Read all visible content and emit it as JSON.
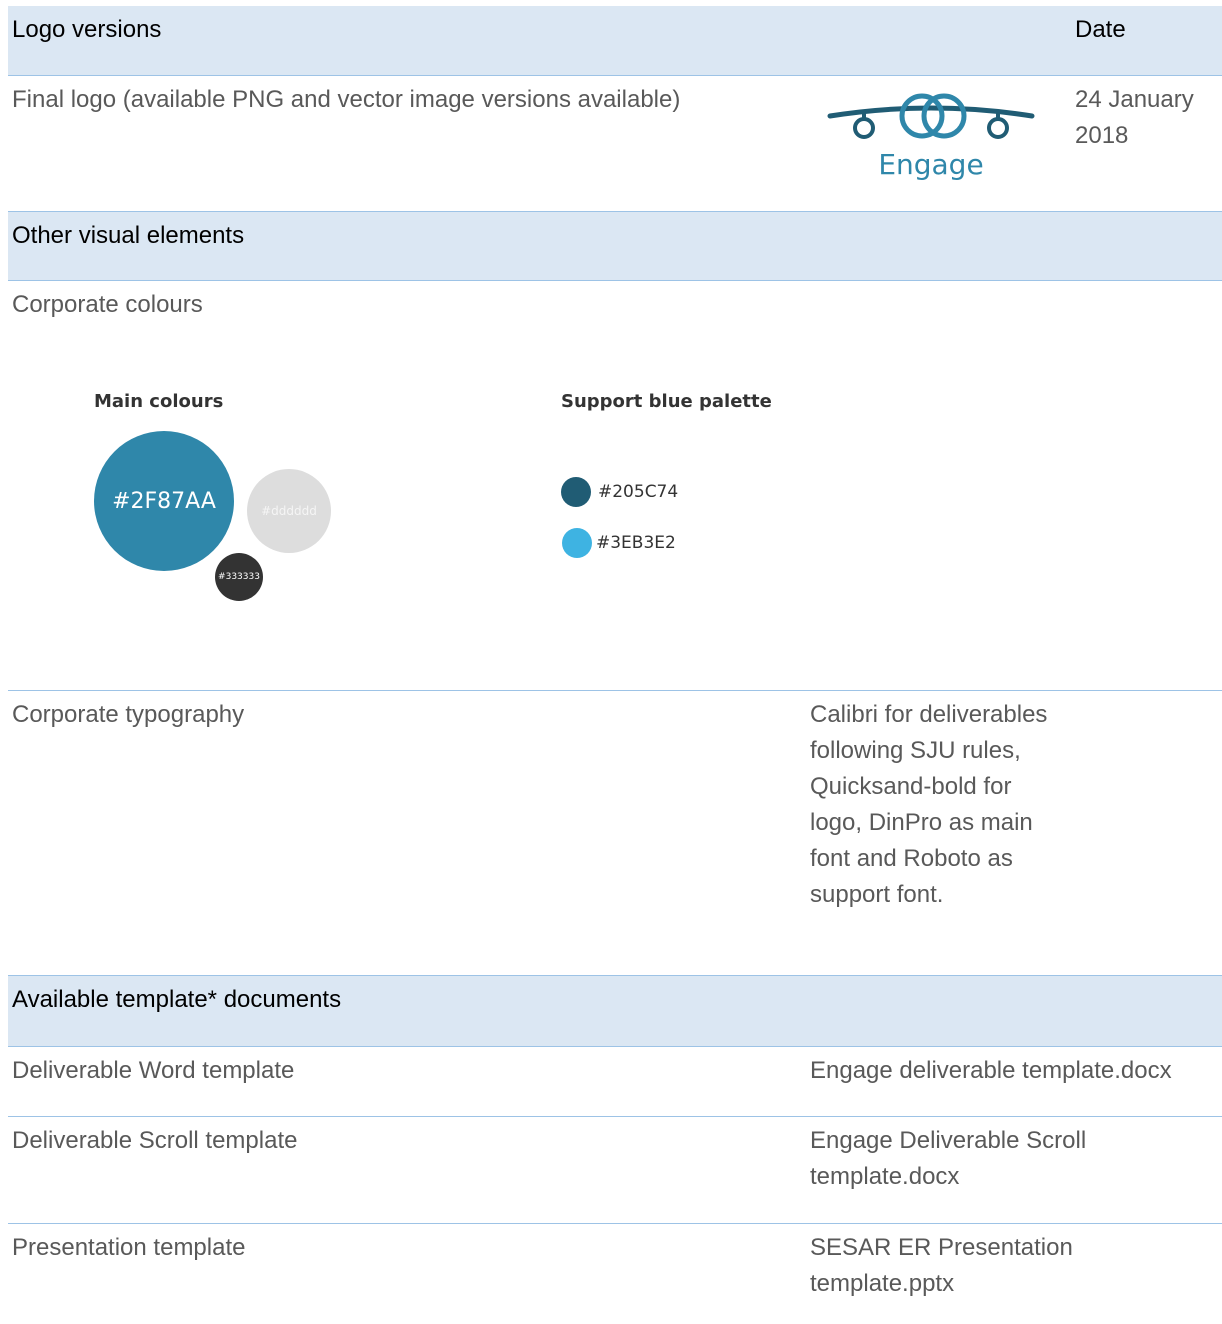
{
  "header1": {
    "col1": "Logo versions",
    "col3": "Date"
  },
  "logo_row": {
    "label": "Final logo (available PNG and vector image versions available)",
    "logo_text": "Engage",
    "date": "24 January 2018"
  },
  "header2": {
    "col1": "Other visual elements"
  },
  "colours_row": {
    "label": "Corporate colours",
    "main_title": "Main colours",
    "main_colours": [
      {
        "hex": "#2F87AA",
        "label": "#2F87AA"
      },
      {
        "hex": "#dddddd",
        "label": "#dddddd"
      },
      {
        "hex": "#333333",
        "label": "#333333"
      }
    ],
    "support_title": "Support blue palette",
    "support_colours": [
      {
        "hex": "#205C74",
        "label": "#205C74"
      },
      {
        "hex": "#3EB3E2",
        "label": "#3EB3E2"
      }
    ]
  },
  "typography_row": {
    "label": "Corporate typography",
    "value": "Calibri for deliverables following SJU rules, Quicksand-bold for logo, DinPro as main font and Roboto as support font."
  },
  "header3": {
    "col1": "Available template* documents"
  },
  "templates": [
    {
      "label": "Deliverable Word template",
      "file": "Engage deliverable template.docx"
    },
    {
      "label": "Deliverable Scroll template",
      "file": "Engage Deliverable Scroll template.docx"
    },
    {
      "label": "Presentation template",
      "file": "SESAR ER Presentation template.pptx"
    }
  ],
  "colors": {
    "header_bg": "#dbe7f3",
    "rule": "#9dc3e6",
    "logo_teal": "#2F87AA",
    "logo_dark": "#205C74"
  }
}
